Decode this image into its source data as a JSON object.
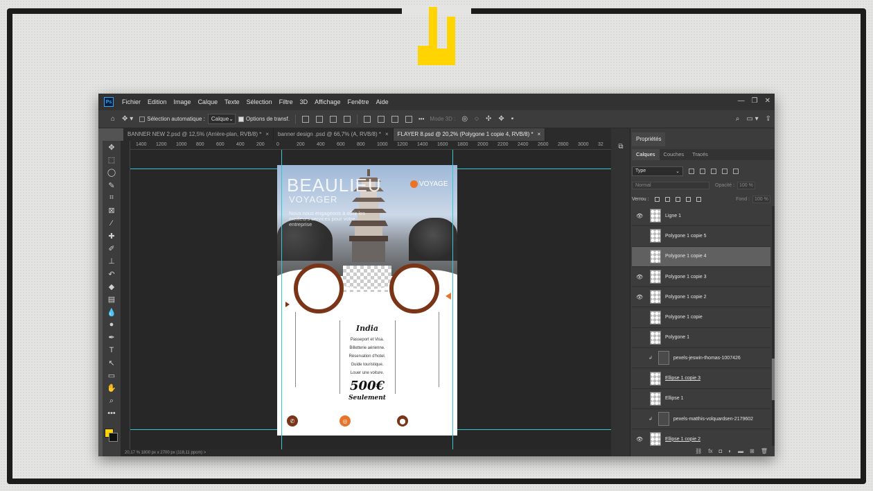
{
  "colors": {
    "logo_yellow": "#ffd400",
    "guide_cyan": "#33c8d8",
    "brown": "#7a3418",
    "orange": "#e8742a"
  },
  "menu": [
    "Fichier",
    "Edition",
    "Image",
    "Calque",
    "Texte",
    "Sélection",
    "Filtre",
    "3D",
    "Affichage",
    "Fenêtre",
    "Aide"
  ],
  "options": {
    "auto_select_label": "Sélection automatique :",
    "auto_select_value": "Calque",
    "transform_label": "Options de transf.",
    "mode3d_label": "Mode 3D :",
    "more": "•••"
  },
  "tabs": [
    {
      "label": "BANNER NEW 2.psd @ 12,5% (Arrière-plan, RVB/8) *",
      "active": false
    },
    {
      "label": "banner design .psd @ 66,7% (A, RVB/8) *",
      "active": false
    },
    {
      "label": "FLAYER 8.psd @ 20,2% (Polygone 1 copie 4, RVB/8) *",
      "active": true
    }
  ],
  "ruler_labels": [
    "1400",
    "1200",
    "1000",
    "800",
    "600",
    "400",
    "200",
    "0",
    "200",
    "400",
    "600",
    "800",
    "1000",
    "1200",
    "1400",
    "1600",
    "1800",
    "2000",
    "2200",
    "2400",
    "2600",
    "2800",
    "3000",
    "32"
  ],
  "status_text": "20,17 %     1800 px x 2700 px (118,11 ppcm)     >",
  "flyer": {
    "title": "BEAULIEU",
    "subtitle": "VOYAGER",
    "tagline": "Nous nous engageons à offrir les meilleurs services pour votre entreprise",
    "brand": "VOYAGE",
    "destination": "India",
    "services": [
      "Passeport et Visa.",
      "Billetterie aérienne.",
      "Réservation d'hotel.",
      "Guide touristique.",
      "Louer une voiture."
    ],
    "price": "500€",
    "price_note": "Seulement"
  },
  "panel": {
    "properties_tab": "Propriétés",
    "tabs": [
      "Calques",
      "Couches",
      "Tracés"
    ],
    "kind_filter": "Type",
    "blend_mode": "Normal",
    "opacity_label": "Opacité :",
    "opacity_value": "100 %",
    "lock_label": "Verrou :",
    "fill_label": "Fond :",
    "fill_value": "100 %"
  },
  "layers": [
    {
      "name": "Ligne 1",
      "visible": true,
      "selected": false,
      "underline": false,
      "photo": false,
      "linked": false
    },
    {
      "name": "Polygone 1 copie 5",
      "visible": false,
      "selected": false,
      "underline": false,
      "photo": false,
      "linked": false
    },
    {
      "name": "Polygone 1 copie 4",
      "visible": false,
      "selected": true,
      "underline": false,
      "photo": false,
      "linked": false
    },
    {
      "name": "Polygone 1 copie 3",
      "visible": true,
      "selected": false,
      "underline": false,
      "photo": false,
      "linked": false
    },
    {
      "name": "Polygone 1 copie 2",
      "visible": true,
      "selected": false,
      "underline": false,
      "photo": false,
      "linked": false
    },
    {
      "name": "Polygone 1 copie",
      "visible": false,
      "selected": false,
      "underline": false,
      "photo": false,
      "linked": false
    },
    {
      "name": "Polygone 1",
      "visible": false,
      "selected": false,
      "underline": false,
      "photo": false,
      "linked": false
    },
    {
      "name": "pexels-jeswin-thomas-1007426",
      "visible": false,
      "selected": false,
      "underline": false,
      "photo": true,
      "linked": true
    },
    {
      "name": "Ellipse 1 copie 3",
      "visible": false,
      "selected": false,
      "underline": true,
      "photo": false,
      "linked": false
    },
    {
      "name": "Ellipse 1",
      "visible": false,
      "selected": false,
      "underline": false,
      "photo": false,
      "linked": false
    },
    {
      "name": "pexels-matthis-volquardsen-2179602",
      "visible": false,
      "selected": false,
      "underline": false,
      "photo": true,
      "linked": true
    },
    {
      "name": "Ellipse 1 copie 2",
      "visible": true,
      "selected": false,
      "underline": true,
      "photo": false,
      "linked": false
    }
  ],
  "tools": [
    "move-tool",
    "marquee-tool",
    "lasso-tool",
    "quick-select-tool",
    "crop-tool",
    "frame-tool",
    "eyedropper-tool",
    "healing-tool",
    "brush-tool",
    "stamp-tool",
    "history-brush-tool",
    "eraser-tool",
    "gradient-tool",
    "blur-tool",
    "dodge-tool",
    "pen-tool",
    "type-tool",
    "path-select-tool",
    "rectangle-tool",
    "hand-tool",
    "zoom-tool",
    "more-tools"
  ]
}
